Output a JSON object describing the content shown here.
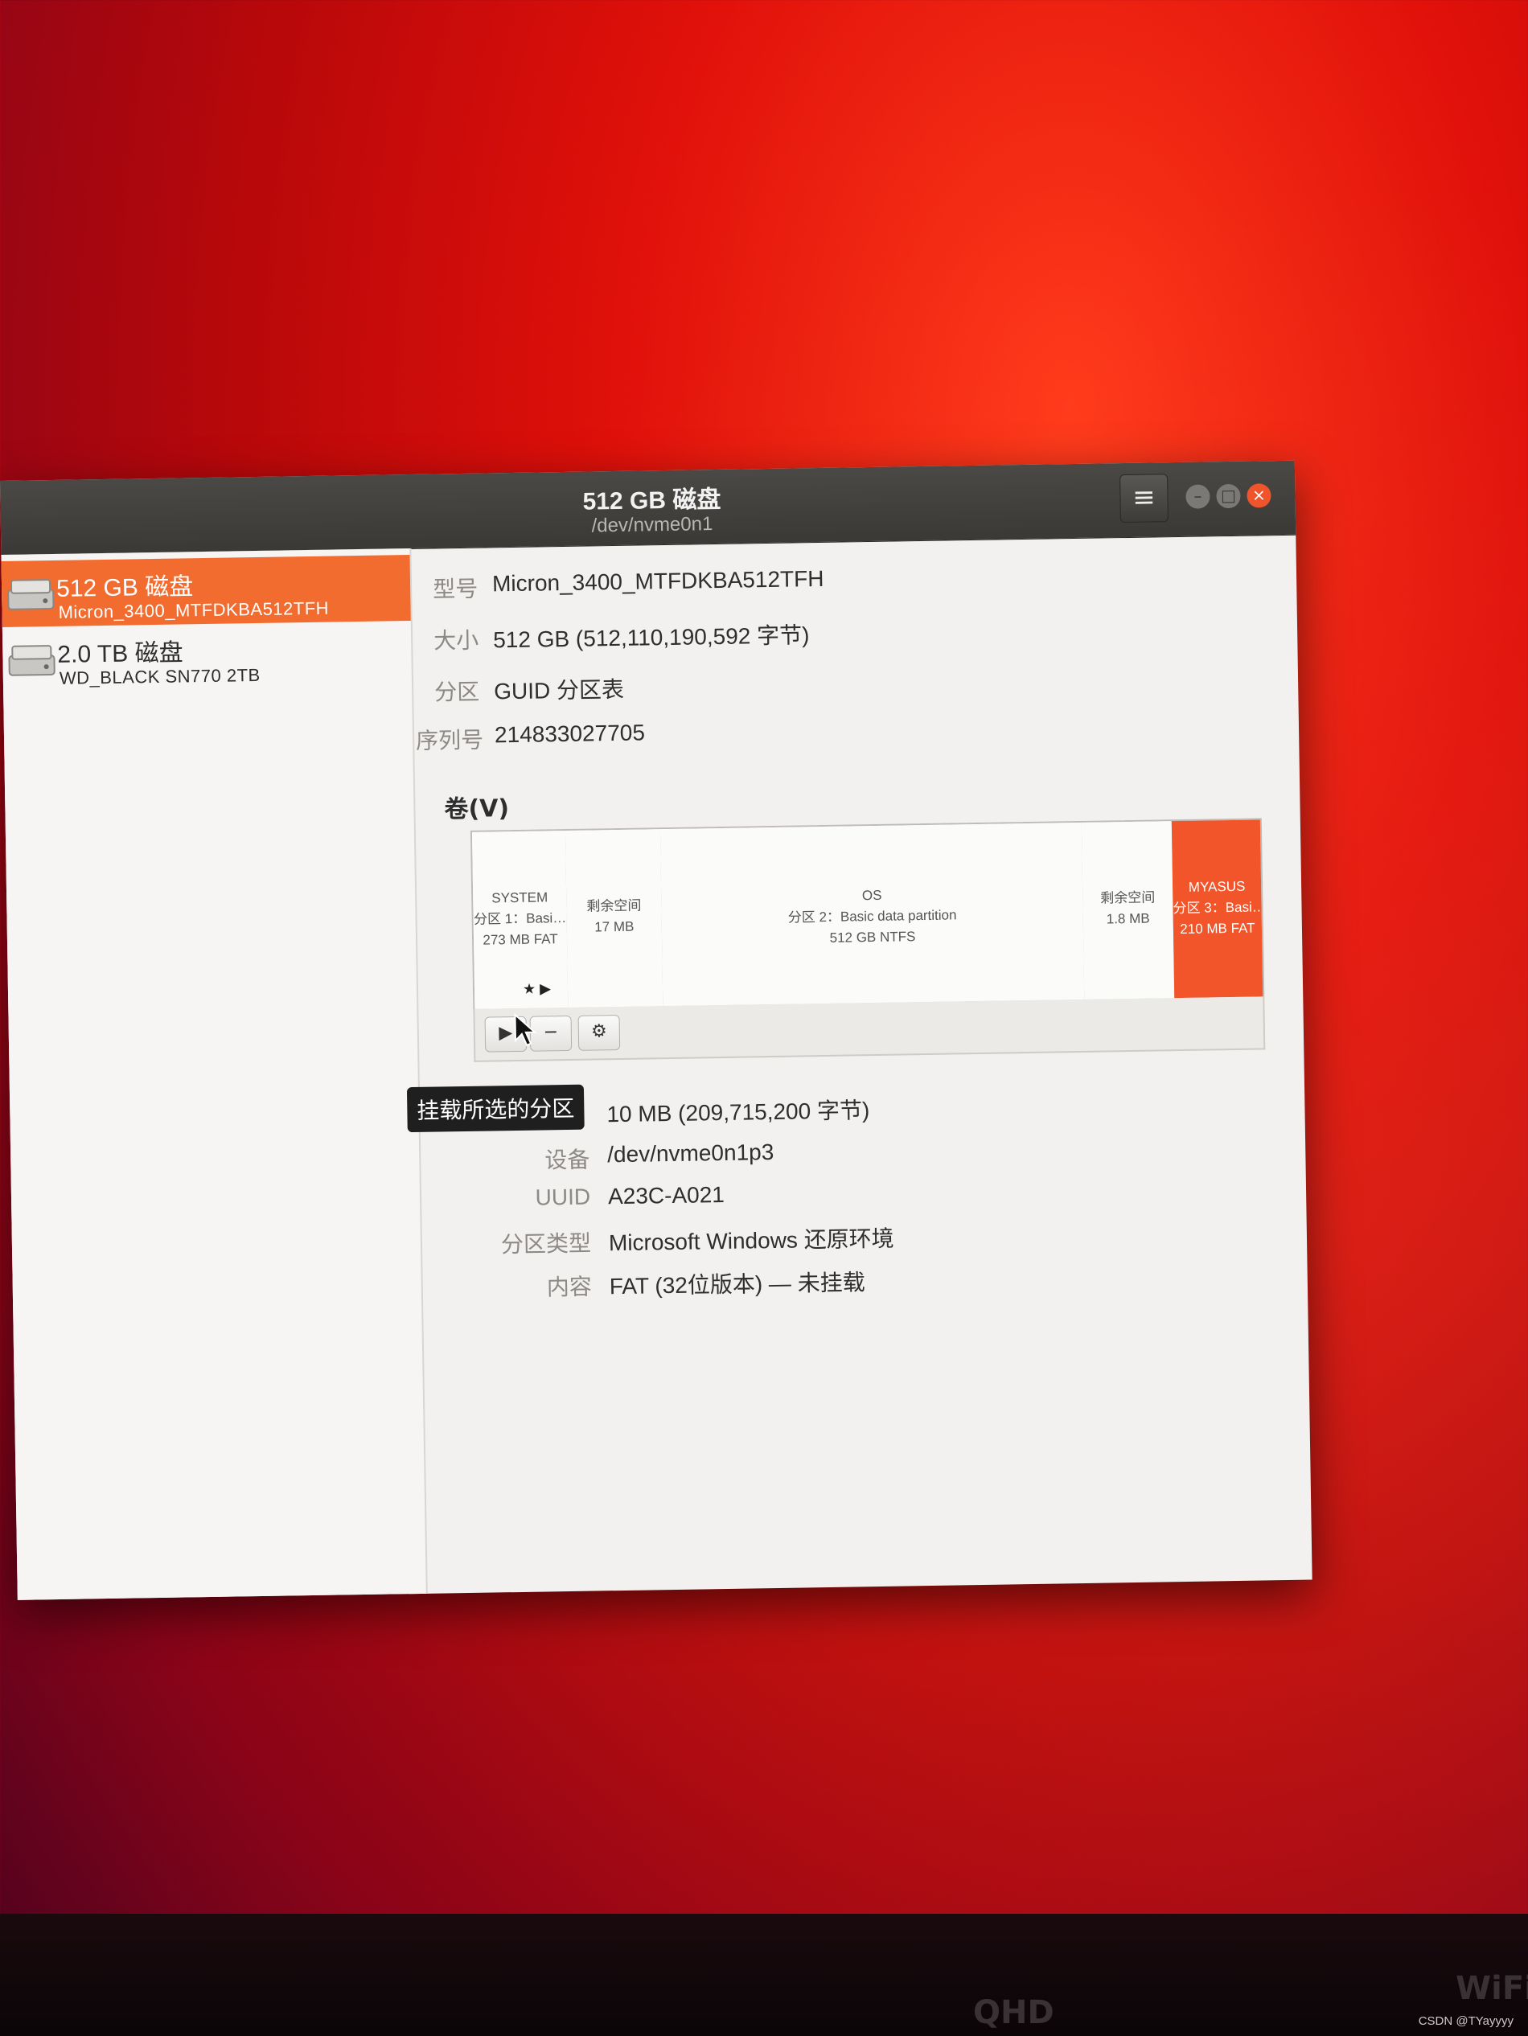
{
  "window": {
    "title": "512 GB 磁盘",
    "subtitle": "/dev/nvme0n1",
    "menu_icon": "hamburger-menu-icon",
    "buttons": [
      "minimize",
      "maximize",
      "close"
    ]
  },
  "sidebar": {
    "drives": [
      {
        "name": "512 GB 磁盘",
        "model": "Micron_3400_MTFDKBA512TFH",
        "selected": true
      },
      {
        "name": "2.0 TB 磁盘",
        "model": "WD_BLACK SN770 2TB",
        "selected": false
      }
    ]
  },
  "disk_info": {
    "model_label": "型号",
    "model_value": "Micron_3400_MTFDKBA512TFH",
    "size_label": "大小",
    "size_value": "512 GB (512,110,190,592 字节)",
    "partitioning_label": "分区",
    "partitioning_value": "GUID 分区表",
    "serial_label": "序列号",
    "serial_value": "214833027705"
  },
  "volumes": {
    "title": "卷(V)",
    "segments": [
      {
        "lines": [
          "SYSTEM",
          "分区 1：Basi…",
          "273 MB FAT"
        ],
        "has_star": true
      },
      {
        "lines": [
          "剩余空间",
          "17 MB"
        ]
      },
      {
        "lines": [
          "OS",
          "分区 2：Basic data partition",
          "512 GB NTFS"
        ]
      },
      {
        "lines": [
          "剩余空间",
          "1.8 MB"
        ]
      },
      {
        "lines": [
          "MYASUS",
          "分区 3：Basi…",
          "210 MB FAT"
        ],
        "selected": true
      }
    ],
    "toolbar": {
      "mount_icon": "play-icon",
      "remove_icon": "minus-icon",
      "settings_icon": "gears-icon"
    },
    "star_text": "★ ▶"
  },
  "tooltip": "挂载所选的分区",
  "partition_info": {
    "size_value": "10 MB (209,715,200 字节)",
    "device_label": "设备",
    "device_value": "/dev/nvme0n1p3",
    "uuid_label": "UUID",
    "uuid_value": "A23C-A021",
    "type_label": "分区类型",
    "type_value": "Microsoft Windows 还原环境",
    "content_label": "内容",
    "content_value": "FAT (32位版本) — 未挂载"
  },
  "monitor": {
    "labels": [
      "QHD",
      "WiFi"
    ],
    "watermark": "CSDN @TYayyyy"
  },
  "colors": {
    "accent": "#f36c2f",
    "selected_segment": "#f2552a",
    "titlebar": "#3b3935",
    "close_button": "#f0542b"
  }
}
